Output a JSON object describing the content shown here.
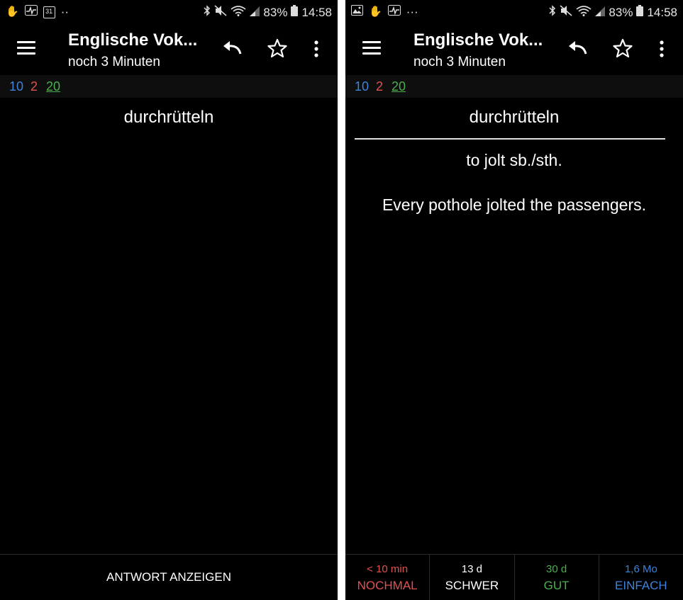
{
  "colors": {
    "new": "#3d83d9",
    "learn": "#e05252",
    "review": "#4caf50",
    "background": "#000000"
  },
  "left": {
    "status": {
      "battery": "83%",
      "time": "14:58",
      "calendar_day": "31",
      "dots": "··"
    },
    "appbar": {
      "title": "Englische Vok...",
      "subtitle": "noch 3 Minuten"
    },
    "counts": {
      "new": "10",
      "learn": "2",
      "review": "20"
    },
    "card": {
      "front": "durchrütteln"
    },
    "bottom": {
      "show_answer": "ANTWORT ANZEIGEN"
    }
  },
  "right": {
    "status": {
      "battery": "83%",
      "time": "14:58",
      "dots": "···"
    },
    "appbar": {
      "title": "Englische Vok...",
      "subtitle": "noch 3 Minuten"
    },
    "counts": {
      "new": "10",
      "learn": "2",
      "review": "20"
    },
    "card": {
      "front": "durchrütteln",
      "back": "to jolt sb./sth.",
      "example": "Every pothole jolted the passengers."
    },
    "ease_buttons": [
      {
        "time": "< 10 min",
        "label": "NOCHMAL"
      },
      {
        "time": "13 d",
        "label": "SCHWER"
      },
      {
        "time": "30 d",
        "label": "GUT"
      },
      {
        "time": "1,6 Mo",
        "label": "EINFACH"
      }
    ]
  },
  "icons": [
    "hand-icon",
    "activity-icon",
    "calendar-icon",
    "image-icon",
    "bluetooth-icon",
    "mute-icon",
    "wifi-icon",
    "signal-icon",
    "battery-icon",
    "menu-icon",
    "undo-icon",
    "star-icon",
    "more-vert-icon"
  ]
}
